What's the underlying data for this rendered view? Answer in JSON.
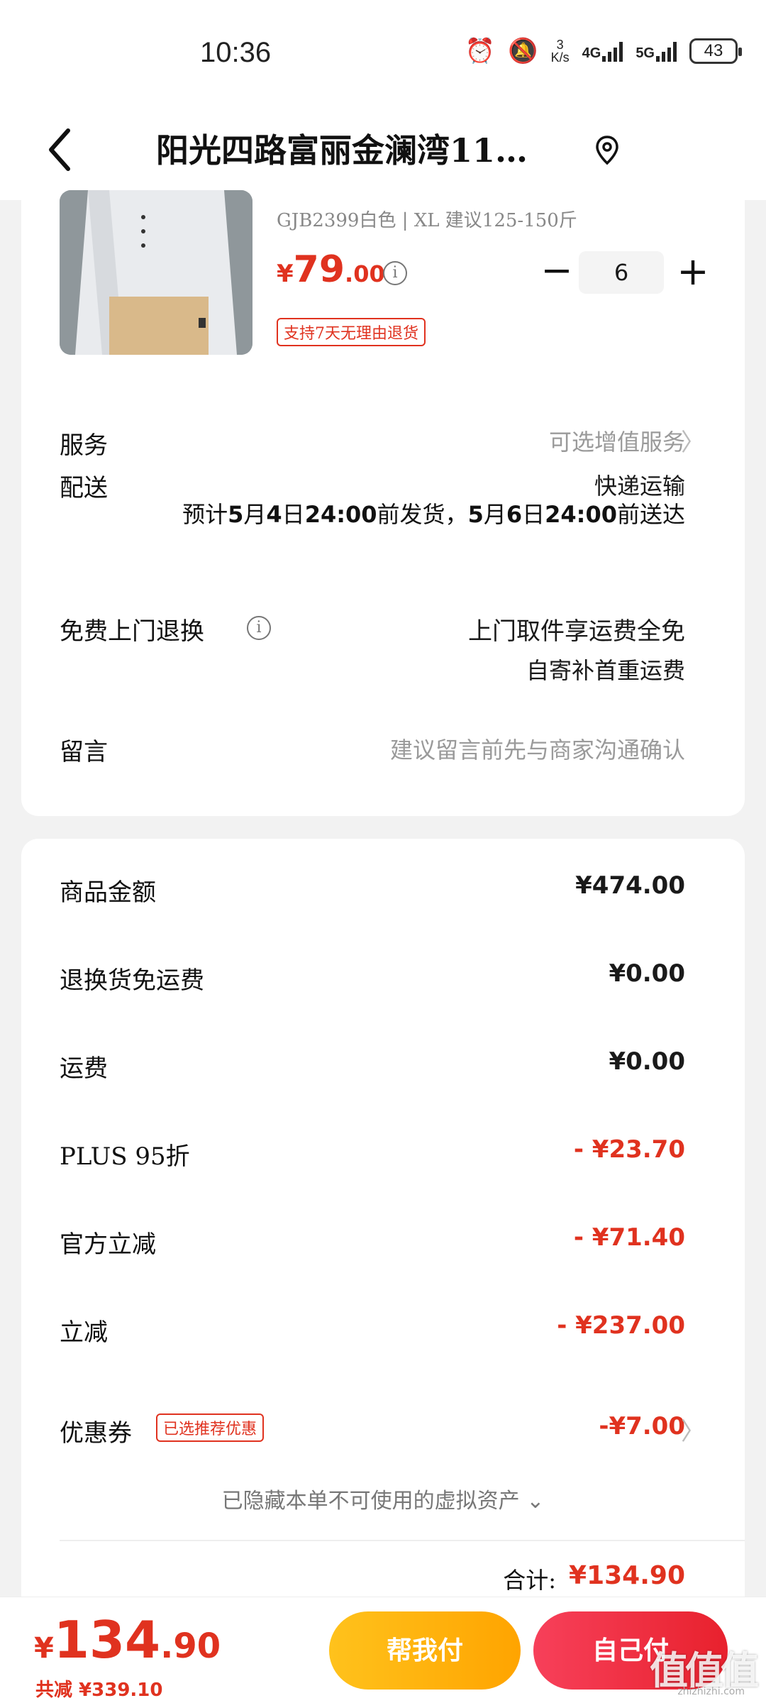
{
  "status_bar": {
    "time": "10:36",
    "speed_top": "3",
    "speed_unit": "K/s",
    "net1": "4G",
    "net2": "5G",
    "battery": "43"
  },
  "header": {
    "title": "阳光四路富丽金澜湾11…",
    "back_icon": "chevron-left-icon",
    "location_icon": "location-pin-icon"
  },
  "product": {
    "spec": "GJB2399白色 | XL  建议125-150斤",
    "price_currency": "¥",
    "price_int": "79",
    "price_dec": ".00",
    "quantity": "6",
    "minus": "−",
    "plus": "+",
    "return_policy": "支持7天无理由退货"
  },
  "service": {
    "label": "服务",
    "value": "可选增值服务",
    "chevron": "〉"
  },
  "delivery": {
    "label": "配送",
    "method": "快递运输",
    "desc_parts": [
      "预计",
      "5",
      "月",
      "4",
      "日",
      "24:00",
      "前发货，",
      "5",
      "月",
      "6",
      "日",
      "24:00",
      "前送达"
    ]
  },
  "free_return": {
    "label": "免费上门退换",
    "value": "上门取件享运费全免",
    "sub": "自寄补首重运费"
  },
  "message": {
    "label": "留言",
    "placeholder": "建议留言前先与商家沟通确认"
  },
  "summary": {
    "rows": [
      {
        "label": "商品金额",
        "amount": "¥474.00"
      },
      {
        "label": "退换货免运费",
        "amount": "¥0.00"
      },
      {
        "label": "运费",
        "amount": "¥0.00"
      },
      {
        "label": "PLUS 95折",
        "amount": "- ¥23.70"
      },
      {
        "label": "官方立减",
        "amount": "- ¥71.40"
      },
      {
        "label": "立减",
        "amount": "- ¥237.00"
      }
    ],
    "coupon_label": "优惠券",
    "coupon_tag": "已选推荐优惠",
    "coupon_amount": "-¥7.00",
    "hidden_assets": "已隐藏本单不可使用的虚拟资产",
    "total_label": "合计:",
    "total_amount": "¥134.90"
  },
  "bottom": {
    "pay_currency": "¥",
    "pay_int": "134",
    "pay_dec": ".90",
    "saved": "共减 ¥339.10",
    "help_pay": "帮我付",
    "self_pay": "自己付",
    "watermark": "值值值",
    "watermark_sub": "zhizhizhi.com"
  },
  "colors": {
    "accent_red": "#e0321f",
    "help_btn": "#ffb300",
    "self_btn": "#ee2b3b"
  }
}
